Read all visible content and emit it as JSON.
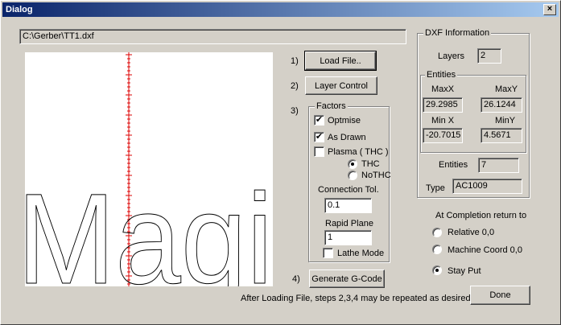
{
  "window": {
    "title": "Dialog",
    "close_glyph": "×"
  },
  "file_path": "C:\\Gerber\\TT1.dxf",
  "preview": {
    "text": "Magi"
  },
  "steps": {
    "s1": "1)",
    "s2": "2)",
    "s3": "3)",
    "s4": "4)"
  },
  "buttons": {
    "load_file": "Load File..",
    "layer_control": "Layer Control",
    "generate_gcode": "Generate G-Code",
    "done": "Done"
  },
  "factors": {
    "legend": "Factors",
    "optimise": {
      "label": "Optmise",
      "checked": true
    },
    "as_drawn": {
      "label": "As Drawn",
      "checked": true
    },
    "plasma": {
      "label": "Plasma ( THC )",
      "checked": false
    },
    "thc": {
      "label": "THC",
      "selected": true
    },
    "nothc": {
      "label": "NoTHC",
      "selected": false
    },
    "connection_tol_label": "Connection Tol.",
    "connection_tol_value": "0.1",
    "rapid_plane_label": "Rapid Plane",
    "rapid_plane_value": "1",
    "lathe_mode": {
      "label": "Lathe Mode",
      "checked": false
    }
  },
  "dxf": {
    "legend": "DXF Information",
    "layers_label": "Layers",
    "layers_value": "2",
    "entities_group_legend": "Entities",
    "maxx_label": "MaxX",
    "maxx_value": "29.2985",
    "maxy_label": "MaxY",
    "maxy_value": "26.1244",
    "minx_label": "Min X",
    "minx_value": "-20.7015",
    "miny_label": "MinY",
    "miny_value": "4.5671",
    "entities_label": "Entities",
    "entities_value": "7",
    "type_label": "Type",
    "type_value": "AC1009"
  },
  "completion": {
    "label": "At Completion return to",
    "relative": {
      "label": "Relative 0,0",
      "selected": false
    },
    "machine": {
      "label": "Machine Coord 0,0",
      "selected": false
    },
    "stay_put": {
      "label": "Stay Put",
      "selected": true
    }
  },
  "footer_note": "After Loading File, steps 2,3,4 may be repeated as desired.",
  "check_glyph": "✔",
  "colors": {
    "title_start": "#0a246a",
    "title_end": "#a6caf0",
    "axis_red": "#dd0000",
    "face": "#d4d0c8"
  }
}
